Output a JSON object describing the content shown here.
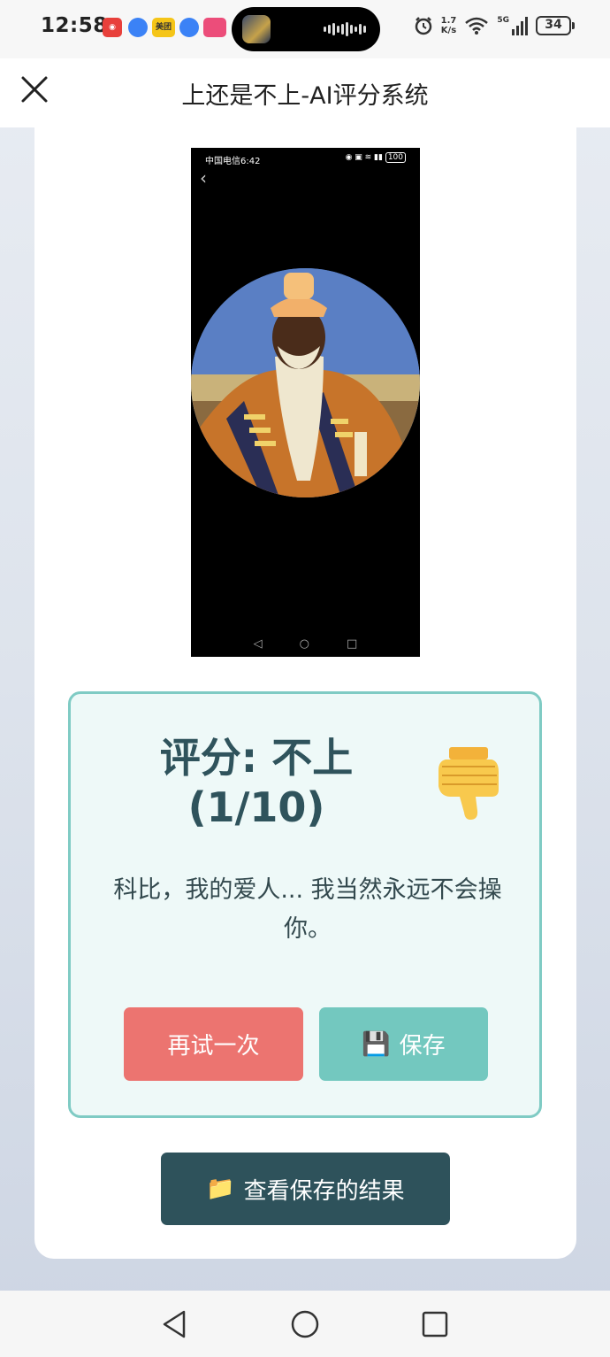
{
  "status_bar": {
    "time": "12:58",
    "net_speed_value": "1.7",
    "net_speed_unit": "K/s",
    "network_type": "5G",
    "battery": "34",
    "app_icons": [
      {
        "name": "netease-music-icon",
        "color": "#e8403b"
      },
      {
        "name": "browser-icon",
        "color": "#3b82f6"
      },
      {
        "name": "meituan-icon",
        "color": "#f5c518",
        "text": "美团"
      },
      {
        "name": "browser-icon-2",
        "color": "#3b82f6"
      },
      {
        "name": "shopping-app-icon",
        "color": "#ec4d7a"
      }
    ]
  },
  "header": {
    "title": "上还是不上-AI评分系统"
  },
  "uploaded_screenshot": {
    "carrier_time": "中国电信6:42",
    "battery": "100"
  },
  "result": {
    "score_line1": "评分: 不上",
    "score_line2": "(1/10)",
    "message": "科比，我的爱人... 我当然永远不会操你。",
    "retry_label": "再试一次",
    "save_label": "保存",
    "save_icon": "💾"
  },
  "view_saved": {
    "label": "查看保存的结果",
    "icon": "📁"
  },
  "colors": {
    "accent_teal": "#73c8bf",
    "retry_red": "#ec7470",
    "dark_teal": "#2e525b",
    "result_border": "#7fcbc4",
    "result_bg": "#eef9f8"
  }
}
